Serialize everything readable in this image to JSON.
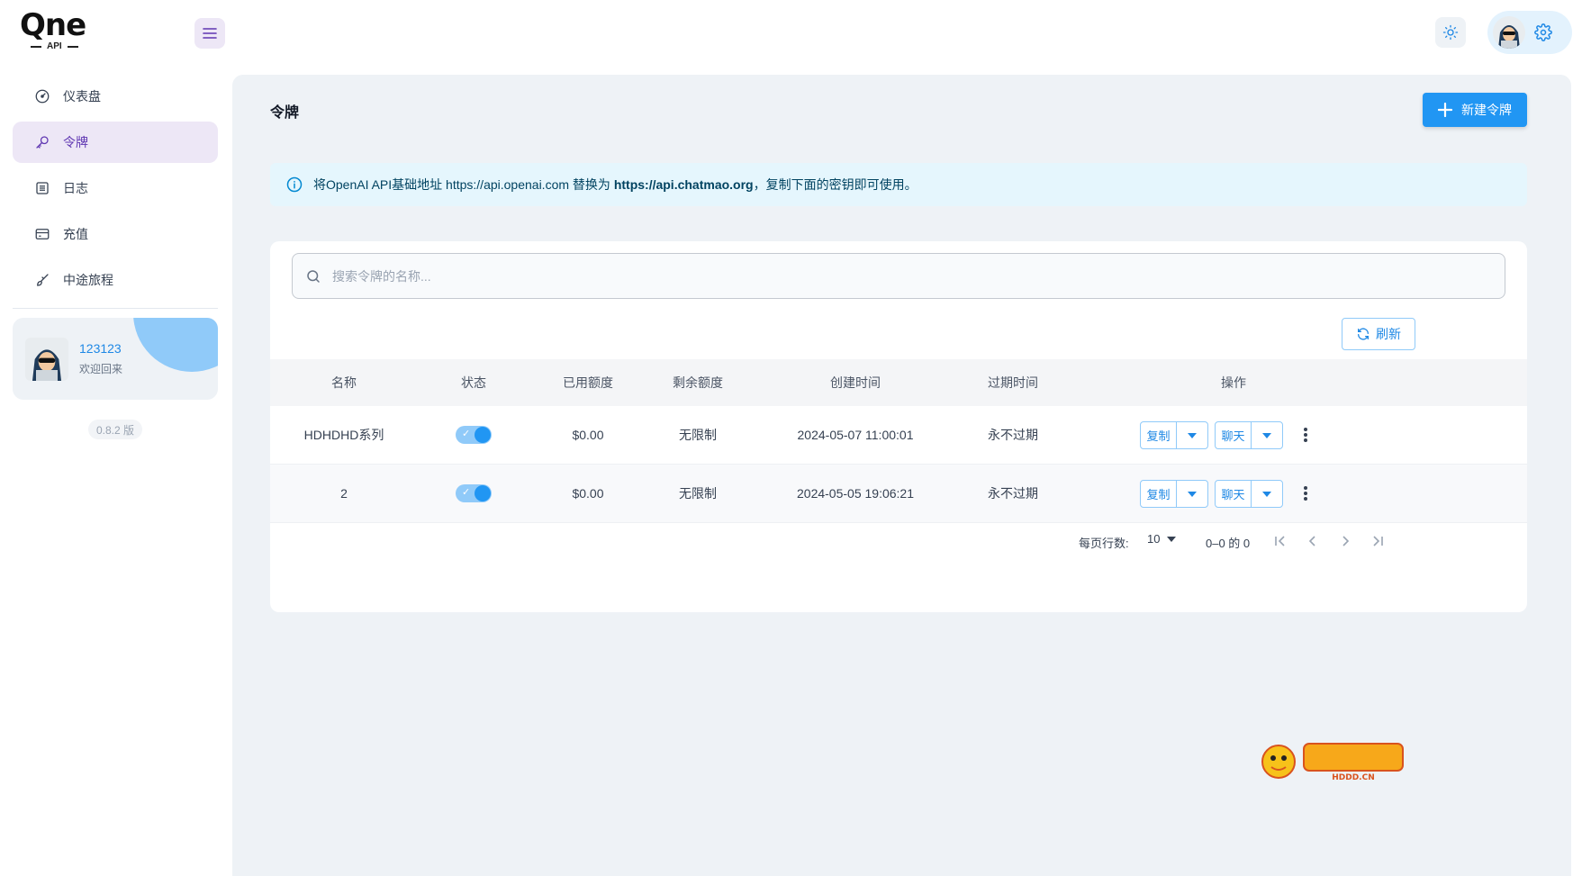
{
  "app": {
    "logo_text": "Qne",
    "logo_sub": "API"
  },
  "sidebar": {
    "items": [
      {
        "label": "仪表盘",
        "icon": "dashboard-icon"
      },
      {
        "label": "令牌",
        "icon": "key-icon",
        "active": true
      },
      {
        "label": "日志",
        "icon": "log-icon"
      },
      {
        "label": "充值",
        "icon": "card-icon"
      },
      {
        "label": "中途旅程",
        "icon": "brush-icon"
      }
    ],
    "user": {
      "name": "123123",
      "welcome": "欢迎回来"
    },
    "version": "0.8.2 版"
  },
  "page": {
    "title": "令牌",
    "new_button": "新建令牌",
    "alert": {
      "prefix": "将OpenAI API基础地址 https://api.openai.com 替换为 ",
      "url": "https://api.chatmao.org",
      "suffix": "，复制下面的密钥即可使用。"
    }
  },
  "search": {
    "placeholder": "搜索令牌的名称..."
  },
  "refresh_label": "刷新",
  "table": {
    "headers": {
      "name": "名称",
      "status": "状态",
      "used": "已用额度",
      "remain": "剩余额度",
      "created": "创建时间",
      "expire": "过期时间",
      "ops": "操作"
    },
    "rows": [
      {
        "name": "HDHDHD系列",
        "status": true,
        "used": "$0.00",
        "remain": "无限制",
        "created": "2024-05-07 11:00:01",
        "expire": "永不过期",
        "copy": "复制",
        "chat": "聊天"
      },
      {
        "name": "2",
        "status": true,
        "used": "$0.00",
        "remain": "无限制",
        "created": "2024-05-05 19:06:21",
        "expire": "永不过期",
        "copy": "复制",
        "chat": "聊天"
      }
    ]
  },
  "pagination": {
    "rows_label": "每页行数:",
    "rows_per_page": "10",
    "range": "0–0 的 0"
  },
  "watermark": {
    "text": "HDDD.CN"
  },
  "colors": {
    "primary": "#2196f3",
    "secondary": "#5e35b1",
    "alert_bg": "#e5f6fd",
    "main_bg": "#eef2f6"
  }
}
